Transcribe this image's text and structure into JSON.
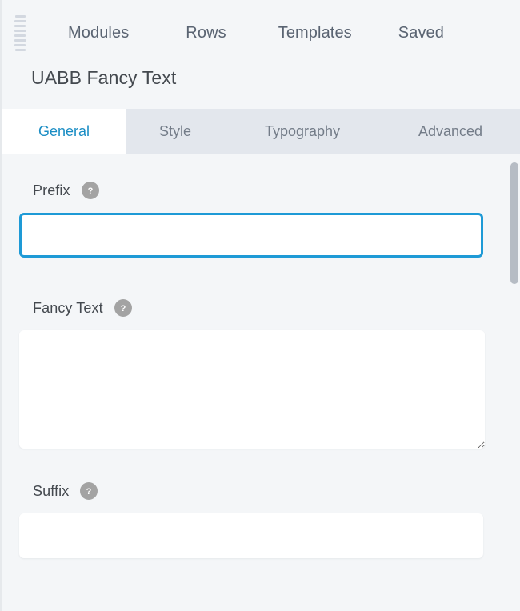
{
  "header": {
    "drag_handle_icon": "drag-handle-icon",
    "nav_items": [
      {
        "label": "Modules"
      },
      {
        "label": "Rows"
      },
      {
        "label": "Templates"
      },
      {
        "label": "Saved"
      }
    ]
  },
  "module": {
    "title": "UABB Fancy Text"
  },
  "tabs": [
    {
      "label": "General",
      "active": true
    },
    {
      "label": "Style",
      "active": false
    },
    {
      "label": "Typography",
      "active": false
    },
    {
      "label": "Advanced",
      "active": false
    }
  ],
  "fields": [
    {
      "label": "Prefix",
      "help_icon": "help-circle-icon",
      "type": "text",
      "value": "",
      "placeholder": "",
      "focused": true
    },
    {
      "label": "Fancy Text",
      "help_icon": "help-circle-icon",
      "type": "textarea",
      "value": "",
      "placeholder": "",
      "focused": false
    },
    {
      "label": "Suffix",
      "help_icon": "help-circle-icon",
      "type": "text",
      "value": "",
      "placeholder": "",
      "focused": false
    }
  ],
  "scrollbar": {
    "name": "vertical-scrollbar"
  },
  "colors": {
    "accent": "#1a8dc4",
    "focus_border": "#1e9ad6",
    "panel_bg": "#f4f6f8",
    "tabbar_bg": "#e3e7ed",
    "text": "#44494f",
    "muted_text": "#737c88",
    "help_icon_bg": "#a3a3a3",
    "scrollbar_thumb": "#b6bcc4"
  }
}
